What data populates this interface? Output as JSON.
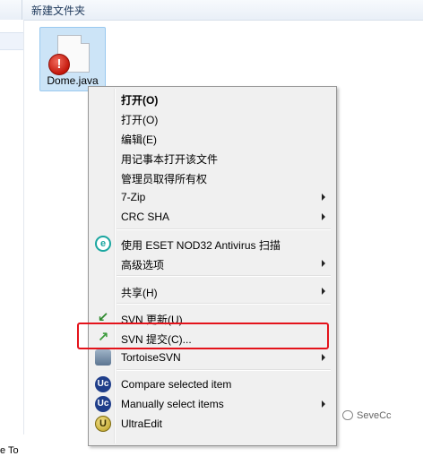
{
  "window": {
    "folder_name": "新建文件夹"
  },
  "nav_pane": {
    "truncated_text": "e To"
  },
  "file": {
    "name": "Dome.java",
    "overlay": "!",
    "overlay_icon": "error-overlay-icon"
  },
  "menu": {
    "items": [
      {
        "label": "打开(O)",
        "bold": true
      },
      {
        "label": "打开(O)"
      },
      {
        "label": "编辑(E)"
      },
      {
        "label": "用记事本打开该文件"
      },
      {
        "label": "管理员取得所有权"
      },
      {
        "label": "7-Zip",
        "submenu": true
      },
      {
        "label": "CRC SHA",
        "submenu": true
      },
      {
        "label": "使用 ESET NOD32 Antivirus 扫描",
        "icon": "eset-icon",
        "icon_text": "e"
      },
      {
        "label": "高级选项",
        "submenu": true
      },
      {
        "label": "共享(H)",
        "submenu": true
      },
      {
        "label": "SVN 更新(U)",
        "icon": "svn-update-icon",
        "icon_text": "↙"
      },
      {
        "label": "SVN 提交(C)...",
        "icon": "svn-commit-icon",
        "icon_text": "↗"
      },
      {
        "label": "TortoiseSVN",
        "submenu": true,
        "icon": "tortoisesvn-icon"
      },
      {
        "label": "Compare selected item",
        "icon": "ultracompare-icon",
        "icon_text": "Uc"
      },
      {
        "label": "Manually select items",
        "submenu": true,
        "icon": "ultracompare-icon",
        "icon_text": "Uc"
      },
      {
        "label": "UltraEdit",
        "icon": "ultraedit-icon",
        "icon_text": "U"
      }
    ]
  },
  "highlight_color": "#e4131b",
  "watermark": {
    "text": "SeveCc"
  }
}
